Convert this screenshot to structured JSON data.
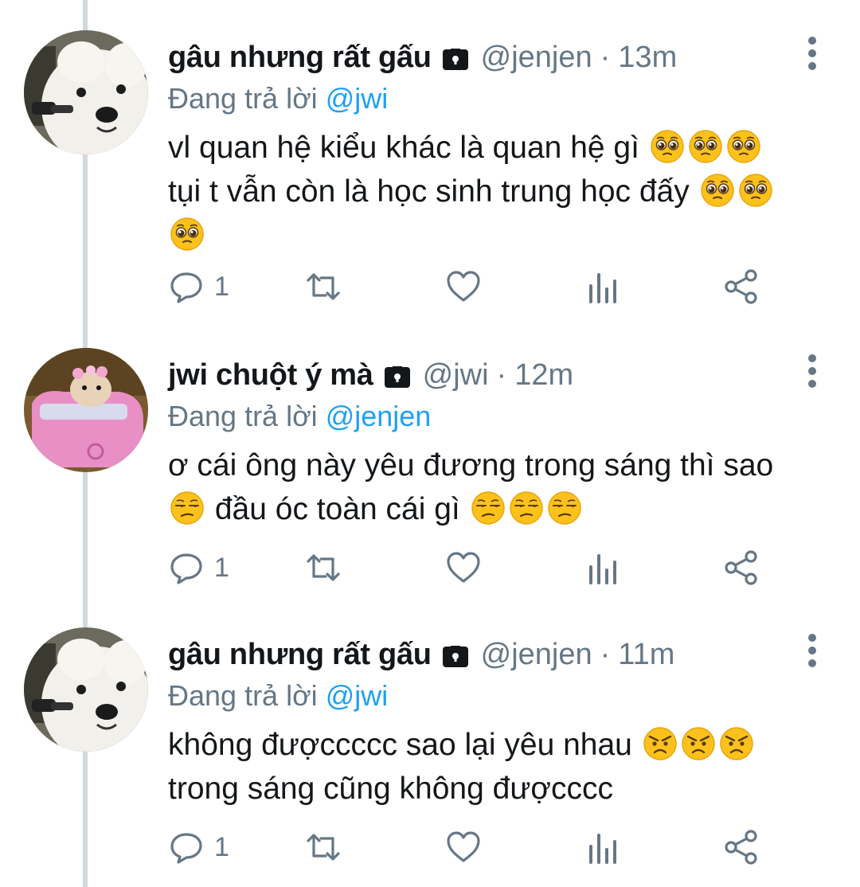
{
  "tweets": [
    {
      "name": "gâu nhưng rất gấu",
      "handle": "@jenjen",
      "separator": "·",
      "time": "13m",
      "reply_prefix": "Đang trả lời",
      "reply_mention": "@jwi",
      "text_line1": "vl quan hệ kiểu khác là quan hệ gì",
      "text_line2": "tụi t vẫn còn là học sinh trung học đấy",
      "emoji": "pleading-face",
      "reply_count": "1"
    },
    {
      "name": "jwi chuột ý mà",
      "handle": "@jwi",
      "separator": "·",
      "time": "12m",
      "reply_prefix": "Đang trả lời",
      "reply_mention": "@jenjen",
      "text_line1": "ơ cái ông này yêu đương trong sáng thì sao",
      "text_line2": "đầu óc toàn cái gì",
      "emoji": "unamused-face",
      "reply_count": "1"
    },
    {
      "name": "gâu nhưng rất gấu",
      "handle": "@jenjen",
      "separator": "·",
      "time": "11m",
      "reply_prefix": "Đang trả lời",
      "reply_mention": "@jwi",
      "text_line1": "không đượccccc sao lại yêu nhau",
      "text_line2": "trong sáng cũng không đượcccc",
      "emoji": "angry-face",
      "reply_count": "1"
    }
  ],
  "colors": {
    "text": "#14171a",
    "secondary": "#657786",
    "mention": "#1da1f2",
    "thread_line": "#cfd9de"
  },
  "icons": [
    "lock-icon",
    "more-vertical-icon",
    "reply-icon",
    "retweet-icon",
    "like-icon",
    "analytics-icon",
    "share-icon"
  ]
}
